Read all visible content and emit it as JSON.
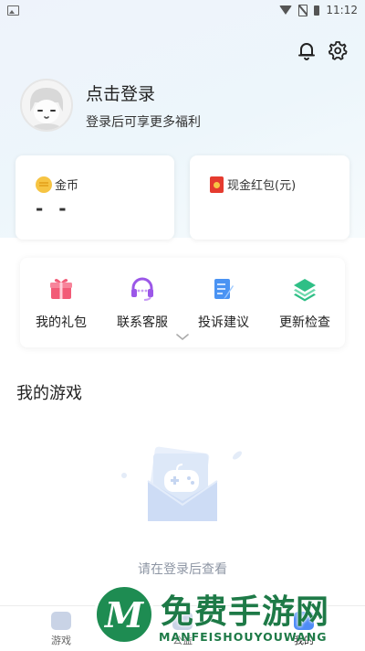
{
  "status_bar": {
    "time": "11:12"
  },
  "profile": {
    "title": "点击登录",
    "subtitle": "登录后可享更多福利"
  },
  "cards": {
    "coins": {
      "label": "金币",
      "value": "- -"
    },
    "cash": {
      "label": "现金红包(元)"
    }
  },
  "menu": {
    "items": [
      {
        "label": "我的礼包",
        "icon": "gift-icon",
        "color": "#f25b77"
      },
      {
        "label": "联系客服",
        "icon": "headset-icon",
        "color": "#9b57e8"
      },
      {
        "label": "投诉建议",
        "icon": "feedback-icon",
        "color": "#4a93f3"
      },
      {
        "label": "更新检查",
        "icon": "layers-icon",
        "color": "#2fbf86"
      }
    ]
  },
  "games_section": {
    "title": "我的游戏",
    "empty_text": "请在登录后查看"
  },
  "bottom_nav": {
    "tabs": [
      {
        "label": "游戏"
      },
      {
        "label": "公益"
      },
      {
        "label": "我的"
      }
    ]
  },
  "watermark": {
    "logo_letter": "M",
    "title": "免费手游网",
    "subtitle": "MANFEISHOUYOUWANG"
  },
  "colors": {
    "accent": "#4f8cf7",
    "watermark_green": "#1e7a47"
  }
}
